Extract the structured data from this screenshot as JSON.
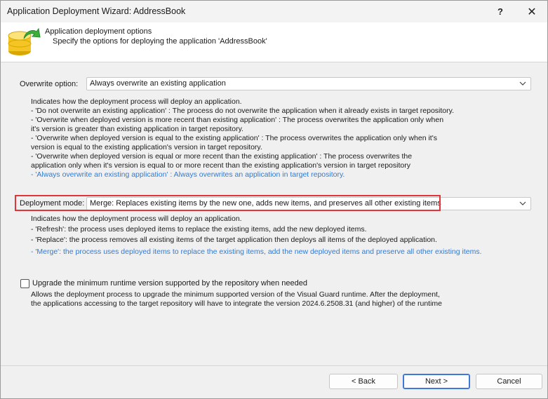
{
  "window": {
    "title": "Application Deployment Wizard: AddressBook",
    "help_label": "?",
    "close_label": "✕"
  },
  "header": {
    "title": "Application deployment options",
    "subtitle": "Specify the options for deploying the application 'AddressBook'",
    "icon": "database-deploy-icon"
  },
  "overwrite": {
    "label": "Overwrite option:",
    "value": "Always overwrite an existing application",
    "description": [
      "Indicates how the deployment process will deploy an application.",
      "- 'Do not overwrite an existing application' : The process do not overwrite the application when it already exists in target repository.",
      "- 'Overwrite when deployed version is more recent than existing application' : The process overwrites the application only when",
      "it's version is greater than existing application in target repository.",
      "- 'Overwrite when deployed version is equal to the existing application' : The process overwrites the application only when it's",
      "version is equal to the existing application's version in target repository.",
      "- 'Overwrite when deployed version is equal or more recent than the existing application' : The process overwrites the",
      "application only when it's version is equal to or more recent than the existing application's version in target repository"
    ],
    "selected_description": "- 'Always overwrite an existing application' : Always overwrites an application in target repository."
  },
  "deployment_mode": {
    "label": "Deployment mode:",
    "value": "Merge: Replaces existing items by the new one, adds new items, and preserves all other existing items",
    "description": [
      "Indicates how the deployment process will deploy an application.",
      "- 'Refresh': the process uses deployed items to replace the existing items, add the new deployed items.",
      "- 'Replace': the process removes all existing items of the target application then deploys all items of the deployed application."
    ],
    "selected_description": "- 'Merge': the process uses deployed items to replace the existing items, add the new deployed items and preserve all other existing items."
  },
  "upgrade": {
    "label": "Upgrade the minimum runtime version supported by the repository when needed",
    "checked": false,
    "description": [
      "Allows the deployment process to upgrade the minimum supported version of the Visual Guard runtime. After the deployment,",
      "the applications accessing to the target repository will have to integrate the version 2024.6.2508.31 (and higher) of the runtime"
    ]
  },
  "buttons": {
    "back": "< Back",
    "next": "Next >",
    "cancel": "Cancel"
  },
  "colors": {
    "highlight": "#e0353b",
    "selected_text": "#2f7bd4",
    "primary_border": "#3e78d8"
  }
}
